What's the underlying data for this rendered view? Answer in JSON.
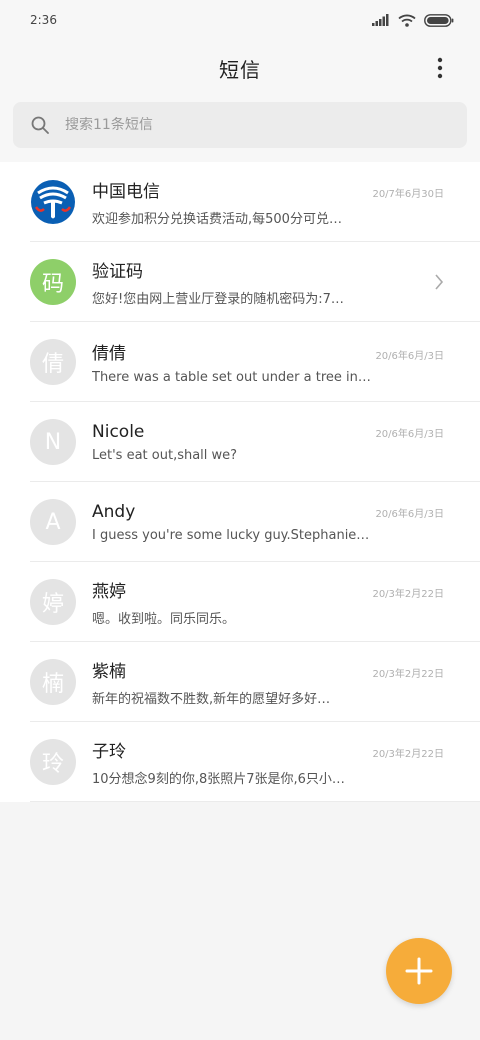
{
  "status_bar": {
    "time": "2:36"
  },
  "header": {
    "title": "短信"
  },
  "search": {
    "placeholder": "搜索11条短信"
  },
  "conversations": [
    {
      "name": "中国电信",
      "date": "20/7年6月30日",
      "preview": "欢迎参加积分兑换话费活动,每500分可兑…",
      "avatar": "china-telecom-logo"
    },
    {
      "name": "验证码",
      "avatar_text": "码",
      "preview": "您好!您由网上营业厅登录的随机密码为:7…"
    },
    {
      "name": "倩倩",
      "avatar_text": "倩",
      "date": "20/6年6月/3日",
      "preview": "There was a table set out under a tree in…"
    },
    {
      "name": "Nicole",
      "avatar_text": "N",
      "date": "20/6年6月/3日",
      "preview": "Let's eat out,shall we?"
    },
    {
      "name": "Andy",
      "avatar_text": "A",
      "date": "20/6年6月/3日",
      "preview": "I guess you're some lucky guy.Stephanie…"
    },
    {
      "name": "燕婷",
      "avatar_text": "婷",
      "date": "20/3年2月22日",
      "preview": "嗯。收到啦。同乐同乐。"
    },
    {
      "name": "紫楠",
      "avatar_text": "楠",
      "date": "20/3年2月22日",
      "preview": "新年的祝福数不胜数,新年的愿望好多好…"
    },
    {
      "name": "子玲",
      "avatar_text": "玲",
      "date": "20/3年2月22日",
      "preview": "10分想念9刻的你,8张照片7张是你,6只小…"
    }
  ],
  "colors": {
    "fab": "#f6ac3a",
    "avatar_green": "#8ecf69",
    "avatar_gray": "#e4e4e4"
  }
}
